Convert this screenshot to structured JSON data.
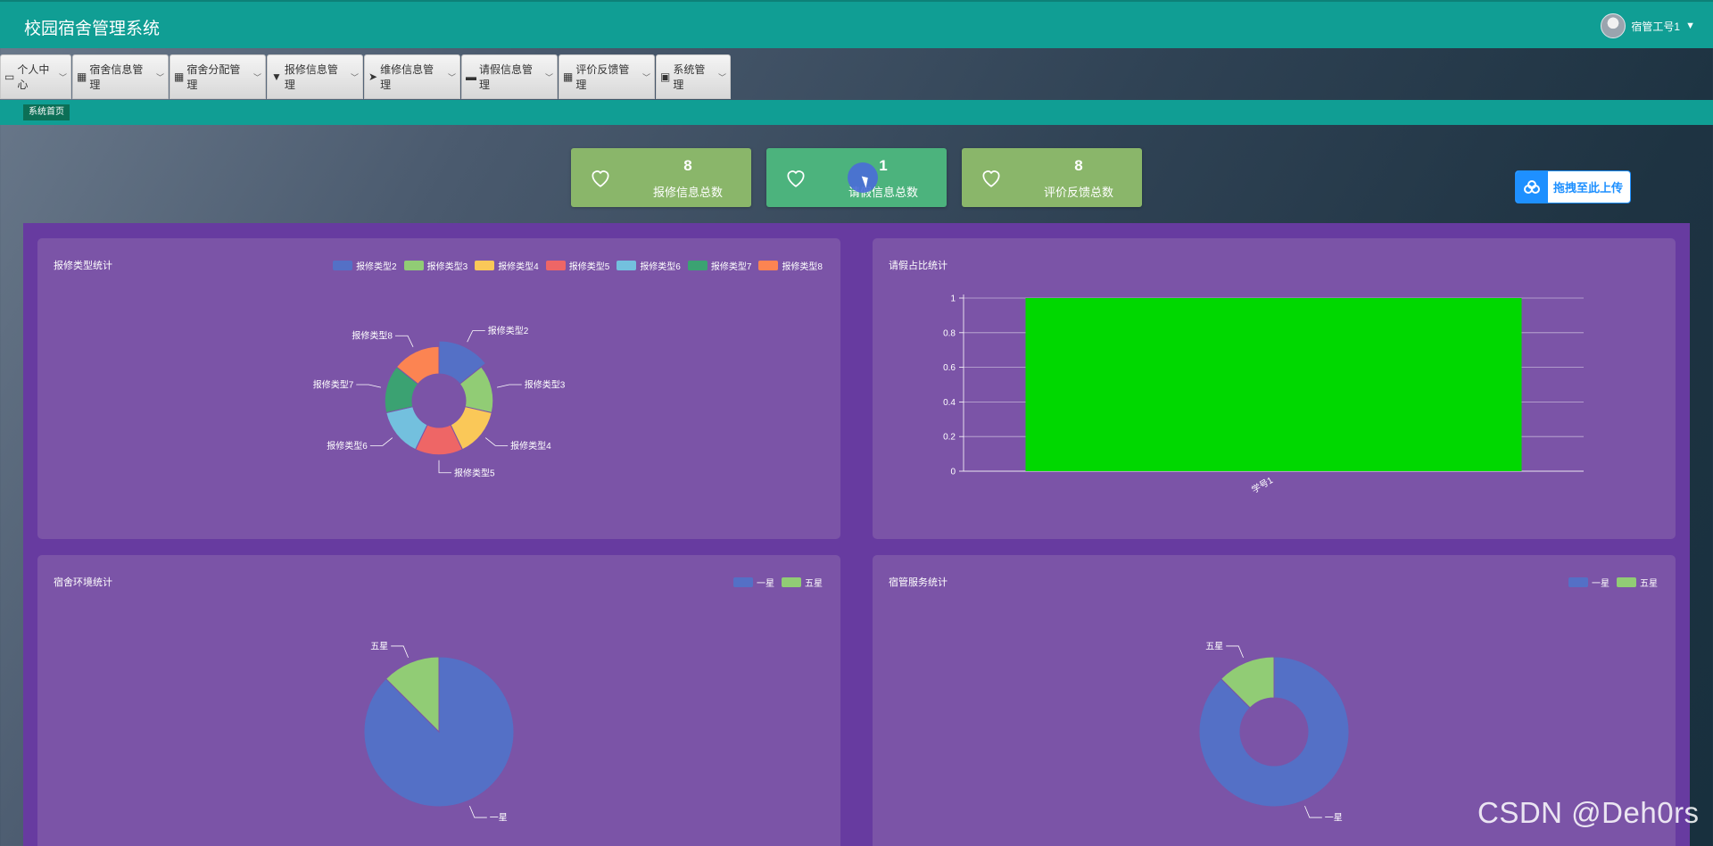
{
  "header": {
    "title": "校园宿舍管理系统",
    "user_label": "宿管工号1",
    "caret": "▼"
  },
  "nav": {
    "items": [
      {
        "label": "个人中心",
        "icon": "▭"
      },
      {
        "label": "宿舍信息管理",
        "icon": "▦"
      },
      {
        "label": "宿舍分配管理",
        "icon": "▦"
      },
      {
        "label": "报修信息管理",
        "icon": "▼"
      },
      {
        "label": "维修信息管理",
        "icon": "➤"
      },
      {
        "label": "请假信息管理",
        "icon": "▬"
      },
      {
        "label": "评价反馈管理",
        "icon": "▦"
      },
      {
        "label": "系统管理",
        "icon": "▣"
      }
    ]
  },
  "breadcrumb": {
    "current": "系统首页"
  },
  "stats": [
    {
      "value": "8",
      "label": "报修信息总数",
      "color": "#8ab66a"
    },
    {
      "value": "1",
      "label": "请假信息总数",
      "color": "#4cb37d"
    },
    {
      "value": "8",
      "label": "评价反馈总数",
      "color": "#8ab66a"
    }
  ],
  "upload": {
    "label": "拖拽至此上传"
  },
  "panels": {
    "repair_type": {
      "title": "报修类型统计"
    },
    "leave_ratio": {
      "title": "请假占比统计"
    },
    "env": {
      "title": "宿舍环境统计"
    },
    "service": {
      "title": "宿管服务统计"
    }
  },
  "watermark": "CSDN @Deh0rs",
  "chart_data": [
    {
      "type": "pie",
      "title": "报修类型统计",
      "variant": "rose-donut",
      "legend": "top-right",
      "categories": [
        "报修类型2",
        "报修类型3",
        "报修类型4",
        "报修类型5",
        "报修类型6",
        "报修类型7",
        "报修类型8"
      ],
      "values": [
        1.6,
        1,
        1,
        1,
        1,
        1,
        1
      ],
      "colors": [
        "#5470c6",
        "#91cc75",
        "#fac858",
        "#ee6666",
        "#73c0de",
        "#3ba272",
        "#fc8452"
      ]
    },
    {
      "type": "bar",
      "title": "请假占比统计",
      "categories": [
        "学号1"
      ],
      "values": [
        1
      ],
      "ylim": [
        0,
        1
      ],
      "yticks": [
        "0",
        "0.2",
        "0.4",
        "0.6",
        "0.8",
        "1"
      ],
      "color": "#00d800",
      "grid": true
    },
    {
      "type": "pie",
      "title": "宿舍环境统计",
      "legend": "top-right",
      "categories": [
        "一星",
        "五星"
      ],
      "values": [
        7,
        1
      ],
      "colors": [
        "#5470c6",
        "#91cc75"
      ]
    },
    {
      "type": "pie",
      "title": "宿管服务统计",
      "variant": "donut",
      "legend": "top-right",
      "categories": [
        "一星",
        "五星"
      ],
      "values": [
        7,
        1
      ],
      "colors": [
        "#5470c6",
        "#91cc75"
      ]
    }
  ]
}
